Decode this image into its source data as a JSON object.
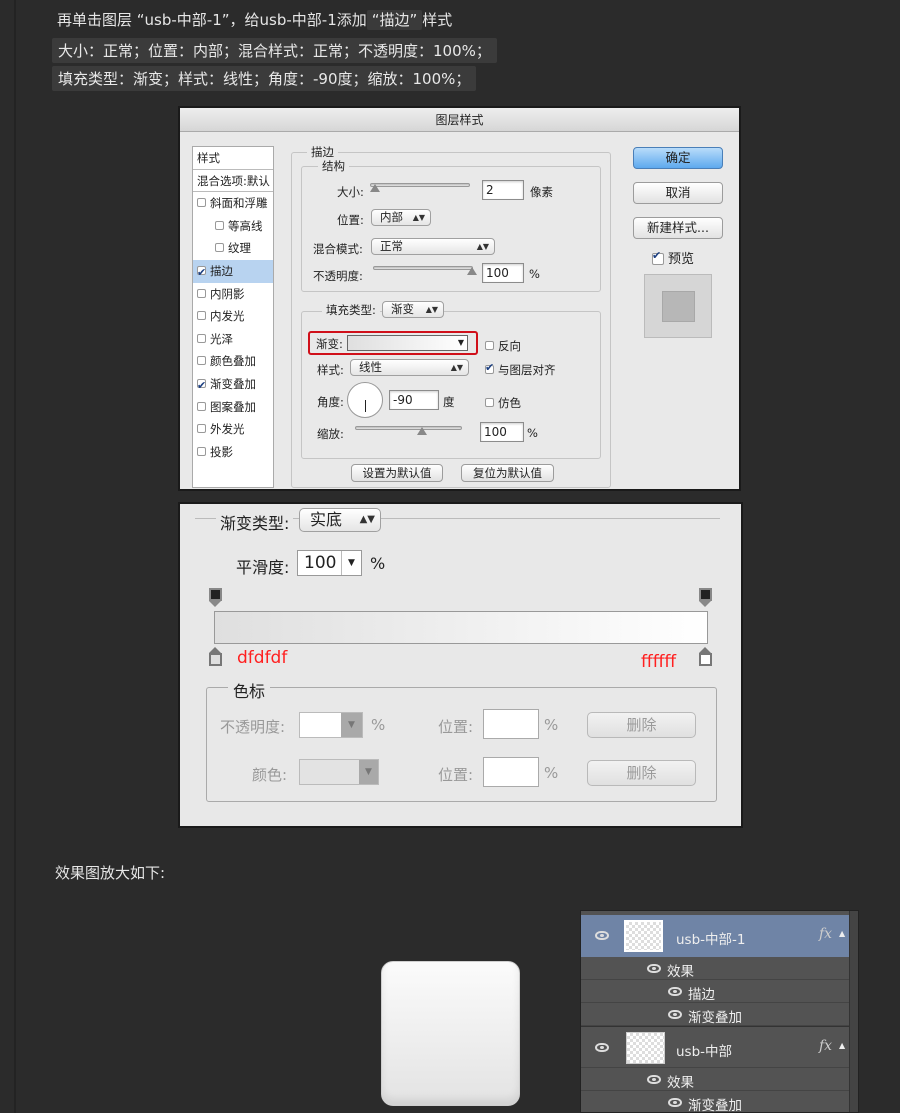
{
  "intro": {
    "line1_a": "再单击图层 “usb-中部-1”，给usb-中部-1添加",
    "line1_hl": "“描边”",
    "line1_b": "样式",
    "line2": "大小：正常；位置：内部；混合样式：正常；不透明度：100%；",
    "line3": "填充类型：渐变；样式：线性；角度：-90度；缩放：100%；"
  },
  "dialog1": {
    "title": "图层样式",
    "style_list": {
      "header": "样式",
      "blend_options": "混合选项:默认",
      "items": [
        {
          "label": "斜面和浮雕",
          "checked": false,
          "indent": false
        },
        {
          "label": "等高线",
          "checked": false,
          "indent": true
        },
        {
          "label": "纹理",
          "checked": false,
          "indent": true
        },
        {
          "label": "描边",
          "checked": true,
          "indent": false,
          "selected": true
        },
        {
          "label": "内阴影",
          "checked": false,
          "indent": false
        },
        {
          "label": "内发光",
          "checked": false,
          "indent": false
        },
        {
          "label": "光泽",
          "checked": false,
          "indent": false
        },
        {
          "label": "颜色叠加",
          "checked": false,
          "indent": false
        },
        {
          "label": "渐变叠加",
          "checked": true,
          "indent": false
        },
        {
          "label": "图案叠加",
          "checked": false,
          "indent": false
        },
        {
          "label": "外发光",
          "checked": false,
          "indent": false
        },
        {
          "label": "投影",
          "checked": false,
          "indent": false
        }
      ]
    },
    "stroke": {
      "group_label": "描边",
      "structure_label": "结构",
      "size_label": "大小:",
      "size_value": "2",
      "size_unit": "像素",
      "position_label": "位置:",
      "position_value": "内部",
      "blend_label": "混合模式:",
      "blend_value": "正常",
      "opacity_label": "不透明度:",
      "opacity_value": "100",
      "opacity_unit": "%",
      "fill_type_label": "填充类型:",
      "fill_type_value": "渐变",
      "gradient_label": "渐变:",
      "reverse_label": "反向",
      "style_label": "样式:",
      "style_value": "线性",
      "align_label": "与图层对齐",
      "angle_label": "角度:",
      "angle_value": "-90",
      "angle_unit": "度",
      "dither_label": "仿色",
      "scale_label": "缩放:",
      "scale_value": "100",
      "scale_unit": "%",
      "set_default": "设置为默认值",
      "reset_default": "复位为默认值"
    },
    "buttons": {
      "ok": "确定",
      "cancel": "取消",
      "new_style": "新建样式...",
      "preview": "预览"
    }
  },
  "dialog2": {
    "gradient_type_label": "渐变类型:",
    "gradient_type_value": "实底",
    "smoothness_label": "平滑度:",
    "smoothness_value": "100",
    "smoothness_unit": "%",
    "stop_left_color": "dfdfdf",
    "stop_right_color": "ffffff",
    "color_stops_label": "色标",
    "opacity_label": "不透明度:",
    "opacity_unit": "%",
    "color_label": "颜色:",
    "position_label": "位置:",
    "position_unit": "%",
    "delete_label": "删除"
  },
  "result_caption": "效果图放大如下:",
  "layers_panel": {
    "layer1": {
      "name": "usb-中部-1",
      "fx": "fx",
      "effects_label": "效果",
      "effects": [
        "描边",
        "渐变叠加"
      ]
    },
    "layer2": {
      "name": "usb-中部",
      "fx": "fx",
      "effects_label": "效果",
      "effects": [
        "渐变叠加"
      ]
    }
  },
  "colors": {
    "stop_annotation": "#ff2020",
    "selected_row": "#b8d3f0",
    "layer_selected": "#6f84a6",
    "highlight_box": "#d0101a"
  }
}
